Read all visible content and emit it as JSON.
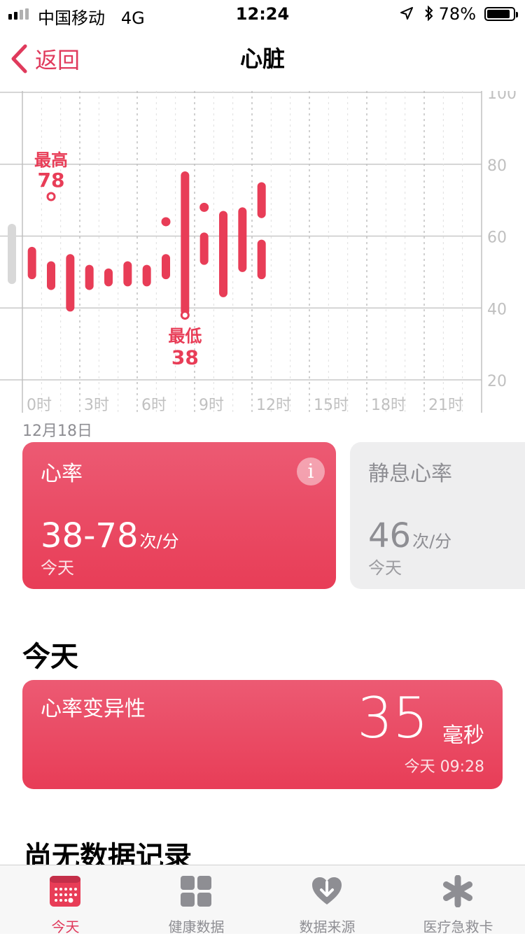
{
  "status": {
    "carrier": "中国移动",
    "network": "4G",
    "time": "12:24",
    "battery": "78%"
  },
  "nav": {
    "back_label": "返回",
    "title": "心脏"
  },
  "chart_data": {
    "type": "range-bar",
    "y_ticks": [
      "100",
      "80",
      "60",
      "40",
      "20"
    ],
    "ylim": [
      20,
      100
    ],
    "x_ticks": [
      "0时",
      "3时",
      "6时",
      "9时",
      "12时",
      "15时",
      "18时",
      "21时"
    ],
    "max_label": "最高",
    "max_value": "78",
    "min_label": "最低",
    "min_value": "38",
    "ranges": [
      {
        "h": 0.5,
        "lo": 48,
        "hi": 57
      },
      {
        "h": 1.5,
        "lo": 45,
        "hi": 53
      },
      {
        "h": 2.5,
        "lo": 39,
        "hi": 55
      },
      {
        "h": 3.5,
        "lo": 45,
        "hi": 52
      },
      {
        "h": 4.5,
        "lo": 46,
        "hi": 51
      },
      {
        "h": 5.5,
        "lo": 46,
        "hi": 53
      },
      {
        "h": 6.5,
        "lo": 46,
        "hi": 52
      },
      {
        "h": 7.5,
        "lo": 48,
        "hi": 55
      },
      {
        "h": 8.5,
        "lo": 38,
        "hi": 78
      },
      {
        "h": 9.5,
        "lo": 52,
        "hi": 61
      },
      {
        "h": 10.5,
        "lo": 43,
        "hi": 67
      },
      {
        "h": 11.5,
        "lo": 50,
        "hi": 68
      },
      {
        "h": 12.5,
        "lo": 48,
        "hi": 59
      },
      {
        "h": 12.5,
        "lo": 65,
        "hi": 75
      }
    ],
    "points": [
      {
        "h": 7.5,
        "v": 64
      },
      {
        "h": 9.5,
        "v": 68
      }
    ],
    "marker_max": {
      "h": 1.5,
      "v": 78
    },
    "marker_min": {
      "h": 8.5,
      "v": 38
    }
  },
  "chart_date": "12月18日",
  "card_hr": {
    "title": "心率",
    "value": "38-78",
    "unit": "次/分",
    "sub": "今天",
    "info_icon": "i"
  },
  "card_rest": {
    "title": "静息心率",
    "value": "46",
    "unit": "次/分",
    "sub": "今天"
  },
  "section_today": "今天",
  "card_hrv": {
    "title": "心率变异性",
    "value": "35",
    "unit": "毫秒",
    "time": "今天 09:28"
  },
  "section_none": "尚无数据记录",
  "tabs": [
    {
      "label": "今天",
      "icon": "calendar-icon",
      "active": true
    },
    {
      "label": "健康数据",
      "icon": "grid-icon",
      "active": false
    },
    {
      "label": "数据来源",
      "icon": "heart-download-icon",
      "active": false
    },
    {
      "label": "医疗急救卡",
      "icon": "asterisk-icon",
      "active": false
    }
  ],
  "colors": {
    "accent": "#e83d57",
    "muted": "#8e8e93"
  }
}
